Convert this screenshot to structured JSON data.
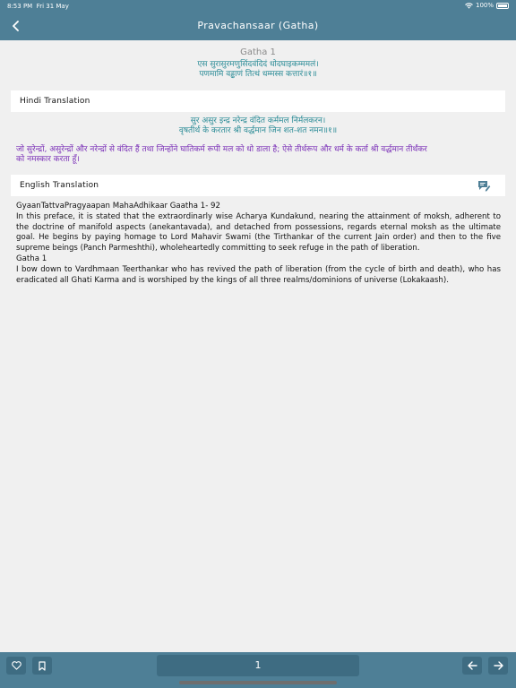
{
  "status": {
    "time": "8:53 PM",
    "date": "Fri 31 May",
    "battery": "100%"
  },
  "nav": {
    "title": "Pravachansaar (Gatha)",
    "back_icon": "chevron-left-icon"
  },
  "gatha": {
    "heading": "Gatha 1",
    "sanskrit_lines": [
      "एस सुरासुरमणुसिंदवंदिदं धोदघाइकम्ममलं।",
      "पणमामि वड्ढाणं तित्थं धम्मस्स कत्तारं॥१॥"
    ]
  },
  "hindi_section": {
    "label": "Hindi Translation",
    "verse_lines": [
      "सुर असुर इन्द्र नरेन्द्र वंदित कर्ममल निर्मलकरन।",
      "वृषतीर्थ के करतार श्री वर्द्धमान जिन शत-शत नमन॥१॥"
    ],
    "paragraph_lines": [
      "जो सुरेन्द्रों, असुरेन्द्रों और नरेन्द्रों से वंदित हैं तथा जिन्होंने घातिकर्म रूपी मल को धो डाला है; ऐसे तीर्थरूप और धर्म के कर्ता श्री वर्द्धमान तीर्थंकर",
      "को नमस्कार करता हूँ।"
    ]
  },
  "english_section": {
    "label": "English Translation",
    "icon": "notes-edit-icon",
    "lines": [
      "GyaanTattvaPragyaapan MahaAdhikaar Gaatha 1- 92",
      "In this preface, it is stated that the extraordinarly wise Acharya Kundakund, nearing the attainment of moksh, adherent to the doctrine of manifold aspects (anekantavada), and detached from possessions, regards eternal moksh as the ultimate goal. He begins by paying homage to Lord Mahavir Swami (the Tirthankar of the current Jain order) and then to the five supreme beings (Panch Parmeshthi), wholeheartedly committing to seek refuge in the path of liberation.",
      "Gatha 1",
      "I bow down to Vardhmaan Teerthankar who has revived the path of liberation (from the cycle of birth and death), who has eradicated all Ghati Karma and is worshiped by the kings of all three realms/dominions of universe (Lokakaash)."
    ]
  },
  "footer": {
    "page": "1",
    "heart_icon": "heart-icon",
    "bookmark_icon": "bookmark-icon",
    "prev_icon": "arrow-left-icon",
    "next_icon": "arrow-right-icon"
  },
  "colors": {
    "primary": "#4e7f96",
    "teal_text": "#2a8b96",
    "purple_text": "#7a2fb7"
  }
}
